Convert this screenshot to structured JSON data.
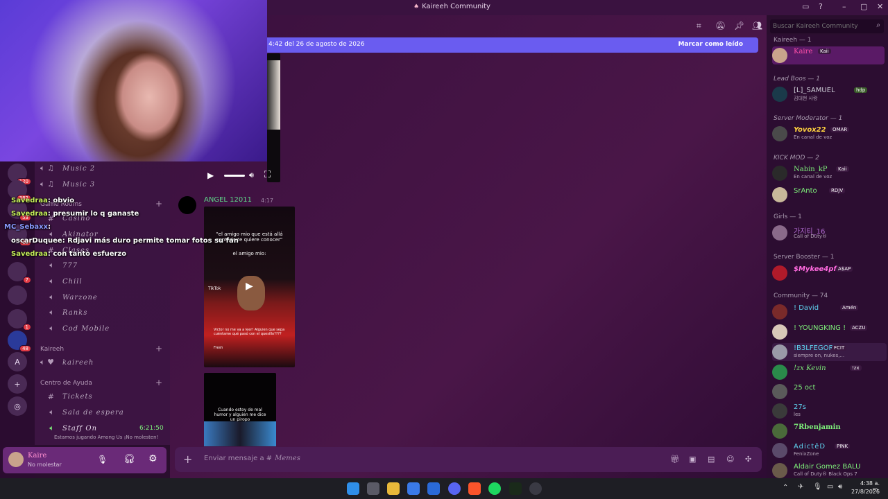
{
  "window": {
    "title": "Kaireeh Community"
  },
  "banner": {
    "text": "4:42 del 26 de agosto de 2026",
    "mark_read": "Marcar como leído"
  },
  "search": {
    "placeholder": "Buscar Kaireeh Community"
  },
  "rail": {
    "badges": [
      "120",
      "382",
      "53",
      "15",
      "7",
      "1",
      "48"
    ],
    "letter": "A"
  },
  "channels": {
    "voice_top": [
      "Music 2",
      "Music 3"
    ],
    "game_rooms_label": "Game Rooms",
    "game_rooms": [
      "Casino",
      "Akinator",
      "Clases",
      "777",
      "Chill",
      "Warzone",
      "Ranks",
      "Cod Mobile"
    ],
    "kaireeh_label": "Kaireeh",
    "kaireeh": [
      "kaireeh"
    ],
    "help_label": "Centro de Ayuda",
    "help": [
      "Tickets",
      "Sala de espera",
      "Staff On"
    ],
    "staff_time": "6:21:50",
    "staff_sub": "Estamos jugando Among Us ¡No molesten!"
  },
  "user_panel": {
    "name": "Kaire",
    "status": "No molestar"
  },
  "chat_overlay": [
    {
      "user": "Savedraa",
      "text": ": obvio"
    },
    {
      "user": "Savedraa",
      "text": ": presumir lo q ganaste"
    },
    {
      "user": "MC_Sebaxx",
      "text": ":"
    },
    {
      "user": "oscarDuquee",
      "text": ": Rdjavi más duro permite tomar fotos su fan"
    },
    {
      "user": "Savedraa",
      "text": ": con tanto esfuerzo"
    }
  ],
  "message": {
    "author": "ANGEL 12011",
    "time": "4:17"
  },
  "video1": {
    "caption1": "\"el amigo mio que está allá sentado te quiere conocer\"",
    "caption2": "el amigo mio:",
    "tiktok": "TikTok",
    "comment": "Victor no me va a leer! Alguien que sepa cuéntame qué pasó con el quesillo????",
    "fresh": "Fresh"
  },
  "video2": {
    "caption": "Cuando estoy de mal humor y alguien me dice un piropo"
  },
  "composer": {
    "placeholder": "Enviar mensaje a #",
    "channel": "Memes"
  },
  "members": {
    "groups": [
      {
        "label": "Kaireeh — 1",
        "items": [
          {
            "name": "Kaire",
            "tag": "Kaii",
            "status": "",
            "color": "#ff4fa8"
          }
        ]
      },
      {
        "label": "Lead Boos — 1",
        "items": [
          {
            "name": "[L]_SAMUEL",
            "tag": "hdp",
            "status": "김대현 사랑",
            "color": "#cfcfd8"
          }
        ]
      },
      {
        "label": "Server Moderator — 1",
        "items": [
          {
            "name": "Yovox22",
            "tag": "OMAR",
            "status": "En canal de voz",
            "color": "#ffd23f"
          }
        ]
      },
      {
        "label": "KICK MOD — 2",
        "items": [
          {
            "name": "Nabin_kP",
            "tag": "Kaii",
            "status": "En canal de voz",
            "color": "#7ef07a"
          },
          {
            "name": "SrAnto",
            "tag": "RDJV",
            "status": "",
            "color": "#7ef07a"
          }
        ]
      },
      {
        "label": "Girls — 1",
        "items": [
          {
            "name": "가지티_16",
            "tag": "",
            "status": "Call of Duty®",
            "color": "#b06ad0"
          }
        ]
      },
      {
        "label": "Server Booster — 1",
        "items": [
          {
            "name": "$Mykee4pf",
            "tag": "A$AP",
            "status": "",
            "color": "#ff6adf"
          }
        ]
      },
      {
        "label": "Community — 74",
        "items": [
          {
            "name": "! David",
            "tag": "Amén",
            "status": "",
            "color": "#5fd3f0"
          },
          {
            "name": "! YOUNGKING !",
            "tag": "ACZU",
            "status": "",
            "color": "#7ef07a"
          },
          {
            "name": "!B3LFEGOR",
            "tag": "FCIT",
            "status": "siempre on, nukes,...",
            "color": "#5fd3f0"
          },
          {
            "name": "!zx Kevin",
            "tag": "!zx",
            "status": "",
            "color": "#7ef07a"
          },
          {
            "name": "25 oct",
            "tag": "",
            "status": "",
            "color": "#7ef07a"
          },
          {
            "name": "27s",
            "tag": "",
            "status": "les",
            "color": "#5fd3f0"
          },
          {
            "name": "7Rbenjamin",
            "tag": "",
            "status": "",
            "color": "#7ef07a"
          },
          {
            "name": "AdictêD",
            "tag": "PINK",
            "status": "FenixZone",
            "color": "#5fd3f0"
          },
          {
            "name": "Aldair Gomez BALU",
            "tag": "",
            "status": "Call of Duty® Black Ops 7",
            "color": "#7ef07a"
          }
        ]
      }
    ]
  },
  "clock": {
    "time": "4:38 a. m.",
    "date": "27/8/2026"
  }
}
